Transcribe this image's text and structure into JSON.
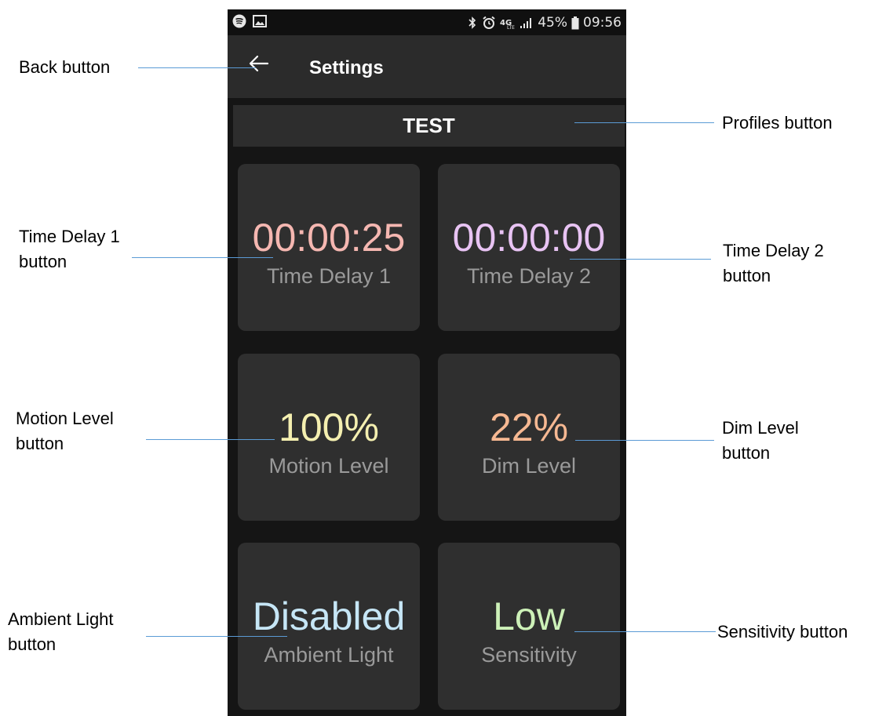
{
  "status_bar": {
    "battery_percent": "45%",
    "time": "09:56",
    "icons": [
      "spotify-icon",
      "image-icon",
      "bluetooth-icon",
      "alarm-icon",
      "4g-icon",
      "signal-icon",
      "battery-icon"
    ]
  },
  "app_bar": {
    "title": "Settings",
    "back_icon": "arrow-left-icon"
  },
  "profile_button": {
    "label": "TEST"
  },
  "tiles": [
    {
      "value": "00:00:25",
      "label": "Time Delay 1",
      "value_color": "#f5b7b1"
    },
    {
      "value": "00:00:00",
      "label": "Time Delay 2",
      "value_color": "#e8c3f3"
    },
    {
      "value": "100%",
      "label": "Motion Level",
      "value_color": "#f4efb0"
    },
    {
      "value": "22%",
      "label": "Dim Level",
      "value_color": "#f6b892"
    },
    {
      "value": "Disabled",
      "label": "Ambient Light",
      "value_color": "#c6e6f6"
    },
    {
      "value": "Low",
      "label": "Sensitivity",
      "value_color": "#cdf1b8"
    }
  ],
  "annotations": {
    "back": [
      "Back button"
    ],
    "profiles": [
      "Profiles button"
    ],
    "time_delay_1": [
      "Time Delay 1",
      "button"
    ],
    "time_delay_2": [
      "Time Delay 2",
      "button"
    ],
    "motion_level": [
      "Motion Level",
      "button"
    ],
    "dim_level": [
      "Dim Level",
      "button"
    ],
    "ambient_light": [
      "Ambient Light",
      "button"
    ],
    "sensitivity": [
      "Sensitivity button"
    ]
  },
  "colors": {
    "annotation_line": "#5b9bd5",
    "screen_bg": "#151515",
    "tile_bg": "#2f2f2f",
    "app_bar_bg": "#2b2b2b"
  }
}
